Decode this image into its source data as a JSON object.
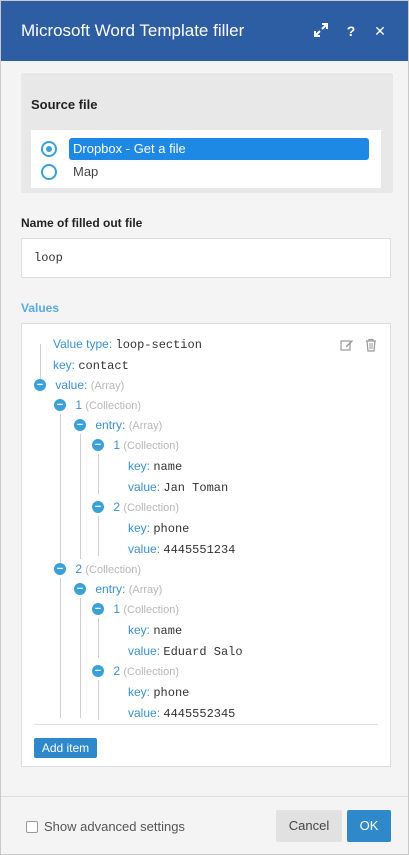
{
  "header": {
    "title": "Microsoft Word Template filler",
    "expand_icon": "expand-icon",
    "help_label": "?",
    "close_label": "✕"
  },
  "source": {
    "title": "Source file",
    "options": [
      {
        "label": "Dropbox - Get a file",
        "selected": true
      },
      {
        "label": "Map",
        "selected": false
      }
    ]
  },
  "filename": {
    "label": "Name of filled out file",
    "value": "loop"
  },
  "values": {
    "label": "Values",
    "rows": [
      {
        "key": "Value type:",
        "val": "loop-section"
      },
      {
        "key": "key:",
        "val": "contact"
      },
      {
        "key": "value:",
        "type": "(Array)"
      },
      {
        "key": "1",
        "type": "(Collection)"
      },
      {
        "key": "entry:",
        "type": "(Array)"
      },
      {
        "key": "1",
        "type": "(Collection)"
      },
      {
        "key": "key:",
        "val": "name"
      },
      {
        "key": "value:",
        "val": "Jan Toman"
      },
      {
        "key": "2",
        "type": "(Collection)"
      },
      {
        "key": "key:",
        "val": "phone"
      },
      {
        "key": "value:",
        "val": "4445551234"
      },
      {
        "key": "2",
        "type": "(Collection)"
      },
      {
        "key": "entry:",
        "type": "(Array)"
      },
      {
        "key": "1",
        "type": "(Collection)"
      },
      {
        "key": "key:",
        "val": "name"
      },
      {
        "key": "value:",
        "val": "Eduard Salo"
      },
      {
        "key": "2",
        "type": "(Collection)"
      },
      {
        "key": "key:",
        "val": "phone"
      },
      {
        "key": "value:",
        "val": "4445552345"
      }
    ],
    "add_item_label": "Add item"
  },
  "footer": {
    "advanced_label": "Show advanced settings",
    "cancel_label": "Cancel",
    "ok_label": "OK"
  },
  "colors": {
    "header": "#2d5da3",
    "accent": "#2e88c9",
    "selected": "#1e88e5"
  }
}
